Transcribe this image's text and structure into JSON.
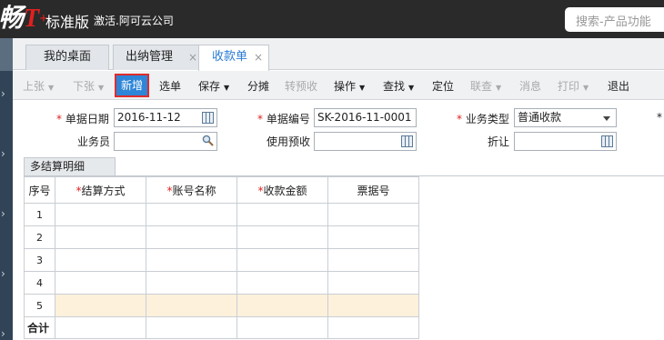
{
  "app": {
    "logo_prefix": "畅",
    "logo_mark": "T",
    "logo_plus": "+",
    "edition": "标准版",
    "activate_text": "激活.阿可云公司",
    "search_placeholder": "搜索-产品功能"
  },
  "tabs": [
    {
      "label": "我的桌面",
      "closable": false
    },
    {
      "label": "出纳管理",
      "closable": true
    },
    {
      "label": "收款单",
      "closable": true,
      "active": true
    }
  ],
  "close_glyph": "×",
  "toolbar": {
    "prev": "上张",
    "next": "下张",
    "new": "新增",
    "select": "选单",
    "save": "保存",
    "allocate": "分摊",
    "to_prepay": "转预收",
    "operate": "操作",
    "find": "查找",
    "locate": "定位",
    "link": "联查",
    "message": "消息",
    "print": "打印",
    "exit": "退出",
    "caret": "▼"
  },
  "form": {
    "required_mark": "*",
    "doc_date_label": "单据日期",
    "doc_date_value": "2016-11-12",
    "doc_no_label": "单据编号",
    "doc_no_value": "SK-2016-11-0001",
    "biz_type_label": "业务类型",
    "biz_type_value": "普通收款",
    "salesman_label": "业务员",
    "salesman_value": "",
    "use_prepay_label": "使用预收",
    "use_prepay_value": "",
    "discount_label": "折让",
    "discount_value": ""
  },
  "grid": {
    "tab_label": "多结算明细",
    "columns": [
      "序号",
      "结算方式",
      "账号名称",
      "收款金额",
      "票据号"
    ],
    "required_columns": [
      false,
      true,
      true,
      true,
      false
    ],
    "rows": [
      "1",
      "2",
      "3",
      "4",
      "5"
    ],
    "highlight_row": 5,
    "total_label": "合计"
  },
  "colors": {
    "accent": "#2e86d8",
    "required": "#e02020",
    "highlight_row": "#fdf1dc",
    "topbar": "#2a2a2a",
    "sidebar": "#314457"
  }
}
